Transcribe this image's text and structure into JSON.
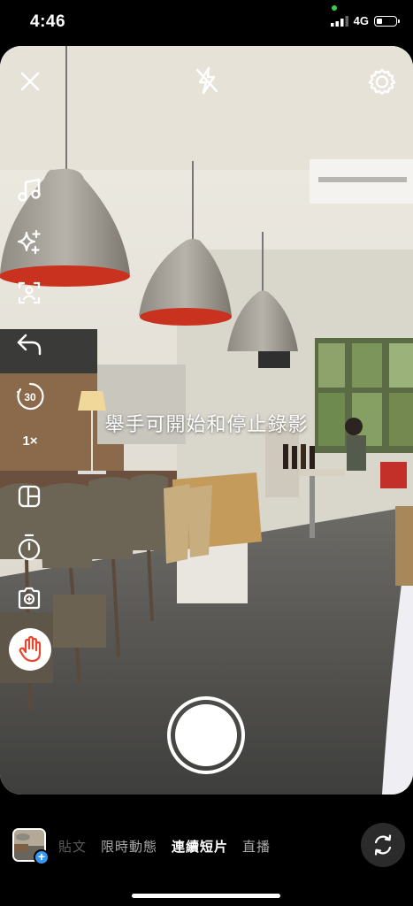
{
  "status": {
    "time": "4:46",
    "network": "4G"
  },
  "camera": {
    "hint_text": "舉手可開始和停止錄影",
    "speed_label": "1×",
    "timer_label": "30"
  },
  "modes": [
    {
      "label": "貼文"
    },
    {
      "label": "限時動態"
    },
    {
      "label": "連續短片"
    },
    {
      "label": "直播"
    }
  ],
  "active_mode": "連續短片",
  "colors": {
    "accent_blue": "#3797f0",
    "hand_icon": "#e8472f",
    "lamp_red": "#c8321e"
  },
  "icons": [
    "close-icon",
    "flash-off-icon",
    "settings-icon",
    "music-icon",
    "effects-icon",
    "green-screen-icon",
    "undo-icon",
    "timer-30-icon",
    "layout-icon",
    "countdown-icon",
    "camera-capture-icon",
    "hand-gesture-icon",
    "flip-camera-icon"
  ]
}
